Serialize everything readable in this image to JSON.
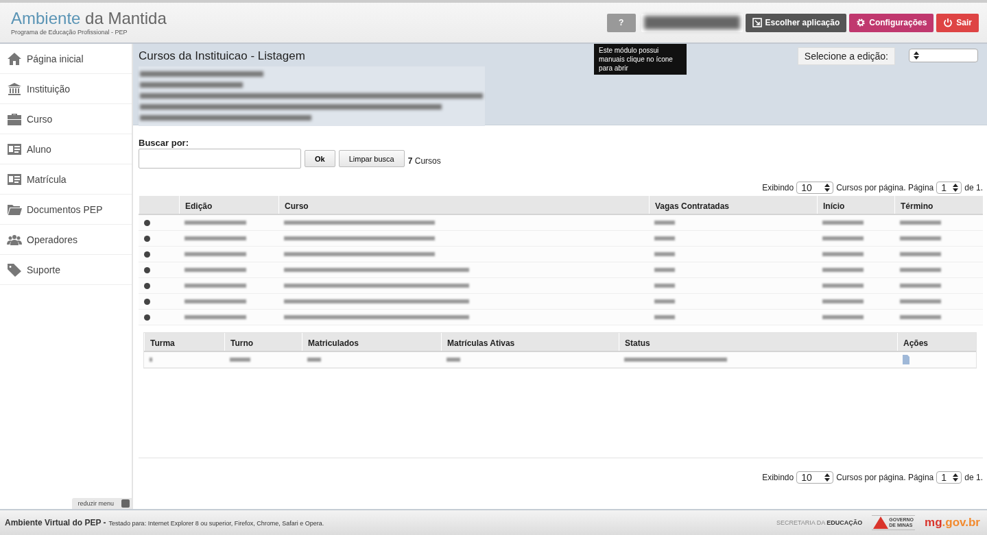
{
  "header": {
    "title_main": "Ambiente",
    "title_rest": "da Mantida",
    "subtitle": "Programa de Educação Profissional - PEP",
    "help_button": "?",
    "user_button": {
      "kind": "blurred"
    },
    "buttons": [
      {
        "label": "Escolher aplicação",
        "kind": "apps"
      },
      {
        "label": "Configurações",
        "kind": "settings"
      },
      {
        "label": "Sair",
        "kind": "logout"
      }
    ],
    "tooltip": "Este módulo possui manuais clique no ícone para abrir"
  },
  "sidebar": {
    "items": [
      {
        "label": "Página inicial"
      },
      {
        "label": "Instituição"
      },
      {
        "label": "Curso"
      },
      {
        "label": "Aluno"
      },
      {
        "label": "Matrícula"
      },
      {
        "label": "Documentos PEP"
      },
      {
        "label": "Operadores"
      },
      {
        "label": "Suporte"
      }
    ],
    "collapse_button": "reduzir menu"
  },
  "page": {
    "title": "Cursos da Instituicao - Listagem",
    "info_lines": [
      {
        "kind": "blurred"
      },
      {
        "kind": "blurred"
      },
      {
        "kind": "blurred"
      },
      {
        "kind": "blurred"
      },
      {
        "kind": "blurred"
      }
    ],
    "edition_label": "Selecione a edição:"
  },
  "search": {
    "label": "Buscar por:",
    "ok_button": "Ok",
    "clear_button": "Limpar busca",
    "count": "**7** Cursos"
  },
  "pager_top": {
    "prefix": "Exibindo",
    "per_page": "10",
    "middle": "Cursos por página. Página",
    "page": "1",
    "suffix": "de 1."
  },
  "table": {
    "columns": [
      "Edição",
      "Curso",
      "Vagas Contratadas",
      "Início",
      "Término"
    ],
    "rows": [
      {
        "kind": "blurred"
      },
      {
        "kind": "blurred"
      },
      {
        "kind": "blurred"
      },
      {
        "kind": "blurred"
      },
      {
        "kind": "blurred"
      },
      {
        "kind": "blurred"
      },
      {
        "kind": "blurred"
      }
    ]
  },
  "subtable": {
    "columns": [
      "Turma",
      "Turno",
      "Matriculados",
      "Matrículas Ativas",
      "Status",
      "Ações"
    ],
    "rows": [
      {
        "kind": "blurred"
      }
    ]
  },
  "pager_bottom": {
    "prefix": "Exibindo",
    "per_page": "10",
    "middle": "Cursos por página. Página",
    "page": "1",
    "suffix": "de 1."
  },
  "footer": {
    "app_name": "Ambiente Virtual do PEP -",
    "note": "Testado para: Internet Explorer 8 ou superior, Firefox, Chrome, Safari e Opera.",
    "secretaria": "SECRETARIA DA **EDUCAÇÃO**",
    "gov_logo_top": "GOVERNO",
    "gov_logo_bottom": "DE MINAS",
    "site_main": "mg",
    "site_rest": ".gov.br"
  }
}
